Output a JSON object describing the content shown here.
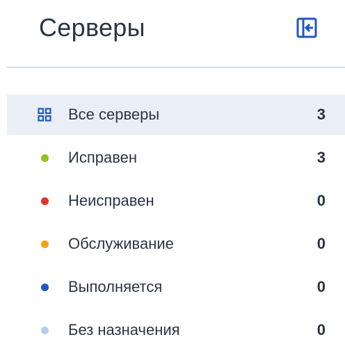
{
  "header": {
    "title": "Серверы",
    "collapse_icon": "collapse-sidebar-icon"
  },
  "colors": {
    "accent": "#1f56c2",
    "active_bg": "#eaeff7",
    "divider": "#cfdaf3",
    "text": "#2b3443"
  },
  "filters": [
    {
      "label": "Все серверы",
      "count": "3",
      "icon": "grid-icon",
      "active": true
    },
    {
      "label": "Исправен",
      "count": "3",
      "icon": "status-dot-icon",
      "color": "#8dc21f"
    },
    {
      "label": "Неисправен",
      "count": "0",
      "icon": "status-dot-icon",
      "color": "#e0312b"
    },
    {
      "label": "Обслуживание",
      "count": "0",
      "icon": "status-dot-icon",
      "color": "#f89f18"
    },
    {
      "label": "Выполняется",
      "count": "0",
      "icon": "status-dot-icon",
      "color": "#1f56c2"
    },
    {
      "label": "Без назначения",
      "count": "0",
      "icon": "status-dot-icon",
      "color": "#b9cbe9"
    }
  ]
}
